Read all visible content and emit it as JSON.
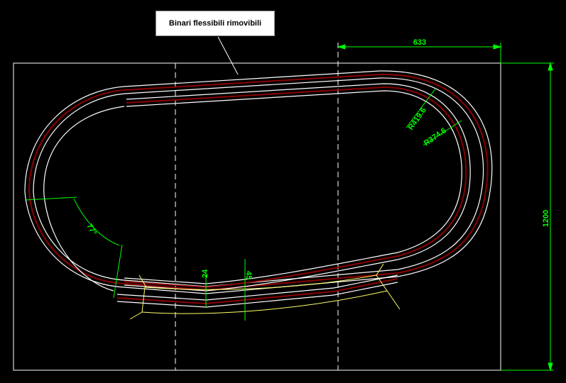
{
  "callout": {
    "text": "Binari flessibili rimovibili"
  },
  "dimensions": {
    "width_633": "633",
    "height_1200": "1200",
    "radius_outer": "R419.6",
    "radius_inner": "R374.6",
    "angle": "77°",
    "gap_24": "24",
    "gap_45": "45"
  },
  "colors": {
    "background": "#000000",
    "track_rail": "#ffffff",
    "track_center": "#8b0000",
    "dimension": "#00ff00",
    "flex_track": "#ffff66"
  }
}
